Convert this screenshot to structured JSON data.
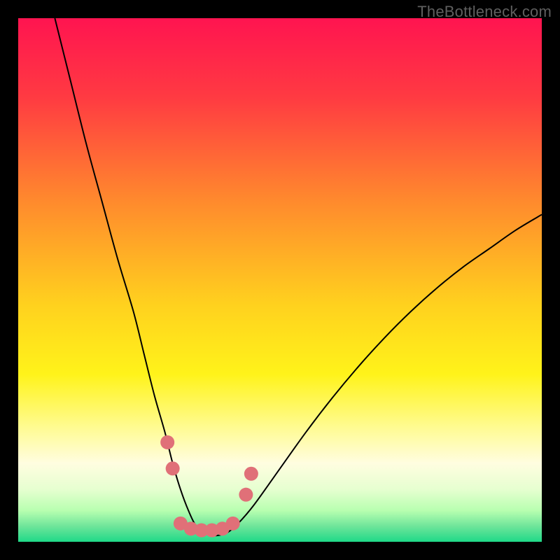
{
  "watermark": "TheBottleneck.com",
  "chart_data": {
    "type": "line",
    "title": "",
    "xlabel": "",
    "ylabel": "",
    "xlim": [
      0,
      100
    ],
    "ylim": [
      0,
      100
    ],
    "grid": false,
    "legend": "none",
    "background_gradient": {
      "stops": [
        {
          "offset": 0.0,
          "color": "#ff1450"
        },
        {
          "offset": 0.15,
          "color": "#ff3a42"
        },
        {
          "offset": 0.35,
          "color": "#ff8a2d"
        },
        {
          "offset": 0.55,
          "color": "#ffd21e"
        },
        {
          "offset": 0.68,
          "color": "#fff31a"
        },
        {
          "offset": 0.78,
          "color": "#fffb90"
        },
        {
          "offset": 0.85,
          "color": "#fffde0"
        },
        {
          "offset": 0.9,
          "color": "#e6ffd0"
        },
        {
          "offset": 0.94,
          "color": "#b8ffb0"
        },
        {
          "offset": 0.97,
          "color": "#6fe59a"
        },
        {
          "offset": 1.0,
          "color": "#1fd988"
        }
      ]
    },
    "series": [
      {
        "name": "bottleneck-curve",
        "color": "#000000",
        "width": 2,
        "x": [
          7,
          10,
          13,
          16,
          19,
          22,
          24,
          26,
          28,
          29.5,
          31,
          32.5,
          34,
          36,
          38,
          40,
          42,
          45,
          50,
          55,
          60,
          65,
          70,
          75,
          80,
          85,
          90,
          95,
          100
        ],
        "y": [
          100,
          88,
          76,
          65,
          54,
          44,
          36,
          28,
          21,
          15,
          10,
          6,
          3,
          1.5,
          1.2,
          1.8,
          3.5,
          7,
          14,
          21,
          27.5,
          33.5,
          39,
          44,
          48.5,
          52.5,
          56,
          59.5,
          62.5
        ]
      },
      {
        "name": "marker-dots",
        "type": "scatter",
        "color": "#e07078",
        "radius": 10,
        "points": [
          {
            "x": 28.5,
            "y": 19
          },
          {
            "x": 29.5,
            "y": 14
          },
          {
            "x": 31.0,
            "y": 3.5
          },
          {
            "x": 33.0,
            "y": 2.5
          },
          {
            "x": 35.0,
            "y": 2.2
          },
          {
            "x": 37.0,
            "y": 2.2
          },
          {
            "x": 39.0,
            "y": 2.5
          },
          {
            "x": 41.0,
            "y": 3.5
          },
          {
            "x": 43.5,
            "y": 9
          },
          {
            "x": 44.5,
            "y": 13
          }
        ]
      }
    ]
  }
}
